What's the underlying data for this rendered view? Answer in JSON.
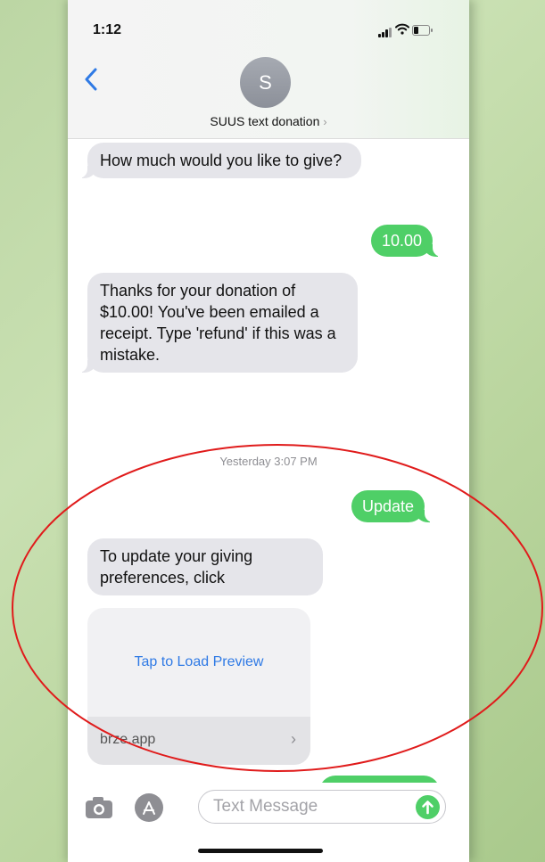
{
  "status_bar": {
    "time": "1:12"
  },
  "header": {
    "back_icon": "chevron-left-icon",
    "avatar_initial": "S",
    "contact_name": "SUUS text donation",
    "contact_chevron": "›"
  },
  "messages": [
    {
      "direction": "incoming",
      "text": "How much would you like to give?"
    },
    {
      "direction": "outgoing",
      "text": "10.00"
    },
    {
      "direction": "incoming",
      "text": "Thanks for your donation of $10.00!  You've been emailed a receipt.  Type 'refund' if this was a mistake."
    },
    {
      "direction": "outgoing",
      "text": "Update"
    },
    {
      "direction": "incoming",
      "text": "To update your giving preferences, click"
    }
  ],
  "timestamp": "Yesterday 3:07 PM",
  "link_preview": {
    "action_text": "Tap to Load Preview",
    "domain": "brze.app",
    "chevron": "›"
  },
  "input_bar": {
    "camera_icon": "camera-icon",
    "apps_icon": "app-store-icon",
    "placeholder": "Text Message",
    "send_icon": "arrow-up-icon"
  },
  "colors": {
    "incoming_bubble": "#e5e5ea",
    "outgoing_bubble": "#4fcf67",
    "link_blue": "#2f7ae5",
    "annotation_red": "#e01b1b"
  }
}
